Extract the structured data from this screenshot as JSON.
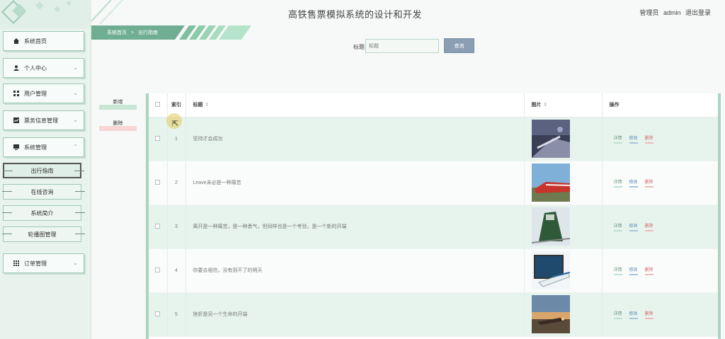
{
  "header": {
    "site_title": "高铁售票模拟系统的设计和开发",
    "role": "管理员",
    "username": "admin",
    "logout": "退出登录"
  },
  "breadcrumb": {
    "home": "系统首页",
    "separator": ">",
    "current": "出行指南"
  },
  "sidebar": {
    "items": [
      {
        "label": "系统首页",
        "icon": "home-icon",
        "expandable": false
      },
      {
        "label": "个人中心",
        "icon": "user-icon",
        "expandable": true
      },
      {
        "label": "用户管理",
        "icon": "grid-icon",
        "expandable": true
      },
      {
        "label": "票务信息管理",
        "icon": "chart-icon",
        "expandable": true
      },
      {
        "label": "系统管理",
        "icon": "monitor-icon",
        "expandable": true,
        "expanded": true
      },
      {
        "label": "订单管理",
        "icon": "apps-icon",
        "expandable": true
      }
    ],
    "sub_items": [
      {
        "label": "出行指南",
        "active": true
      },
      {
        "label": "在线咨询",
        "active": false
      },
      {
        "label": "系统简介",
        "active": false
      },
      {
        "label": "轮播图管理",
        "active": false
      }
    ]
  },
  "search": {
    "label": "标题",
    "placeholder": "标题",
    "button": "查询"
  },
  "actions": {
    "add": "新增",
    "delete": "删除"
  },
  "table": {
    "columns": {
      "index": "索引",
      "title": "标题",
      "image": "图片",
      "ops": "操作"
    },
    "sort_glyph": "⇕",
    "rows": [
      {
        "index": "1",
        "title": "坚持才会成功",
        "image": "train-night"
      },
      {
        "index": "2",
        "title": "Leave未必是一种痛苦",
        "image": "train-red"
      },
      {
        "index": "3",
        "title": "离开是一种痛苦，是一种勇气，但同样也是一个考验，是一个新的开端",
        "image": "train-green"
      },
      {
        "index": "4",
        "title": "你要去相信，没有到不了的明天",
        "image": "train-frame"
      },
      {
        "index": "5",
        "title": "挫折是另一个生命的开端",
        "image": "train-sunset"
      }
    ],
    "row_ops": {
      "detail": "详情",
      "edit": "修改",
      "delete": "删除"
    }
  },
  "colors": {
    "accent": "#7fbfa0",
    "sidebar_bg": "#e8f3ee",
    "row_highlight": "#e7f4ee",
    "search_button": "#8a9fb4",
    "delete_red": "#d06c6c",
    "edit_blue": "#5c88b8"
  }
}
